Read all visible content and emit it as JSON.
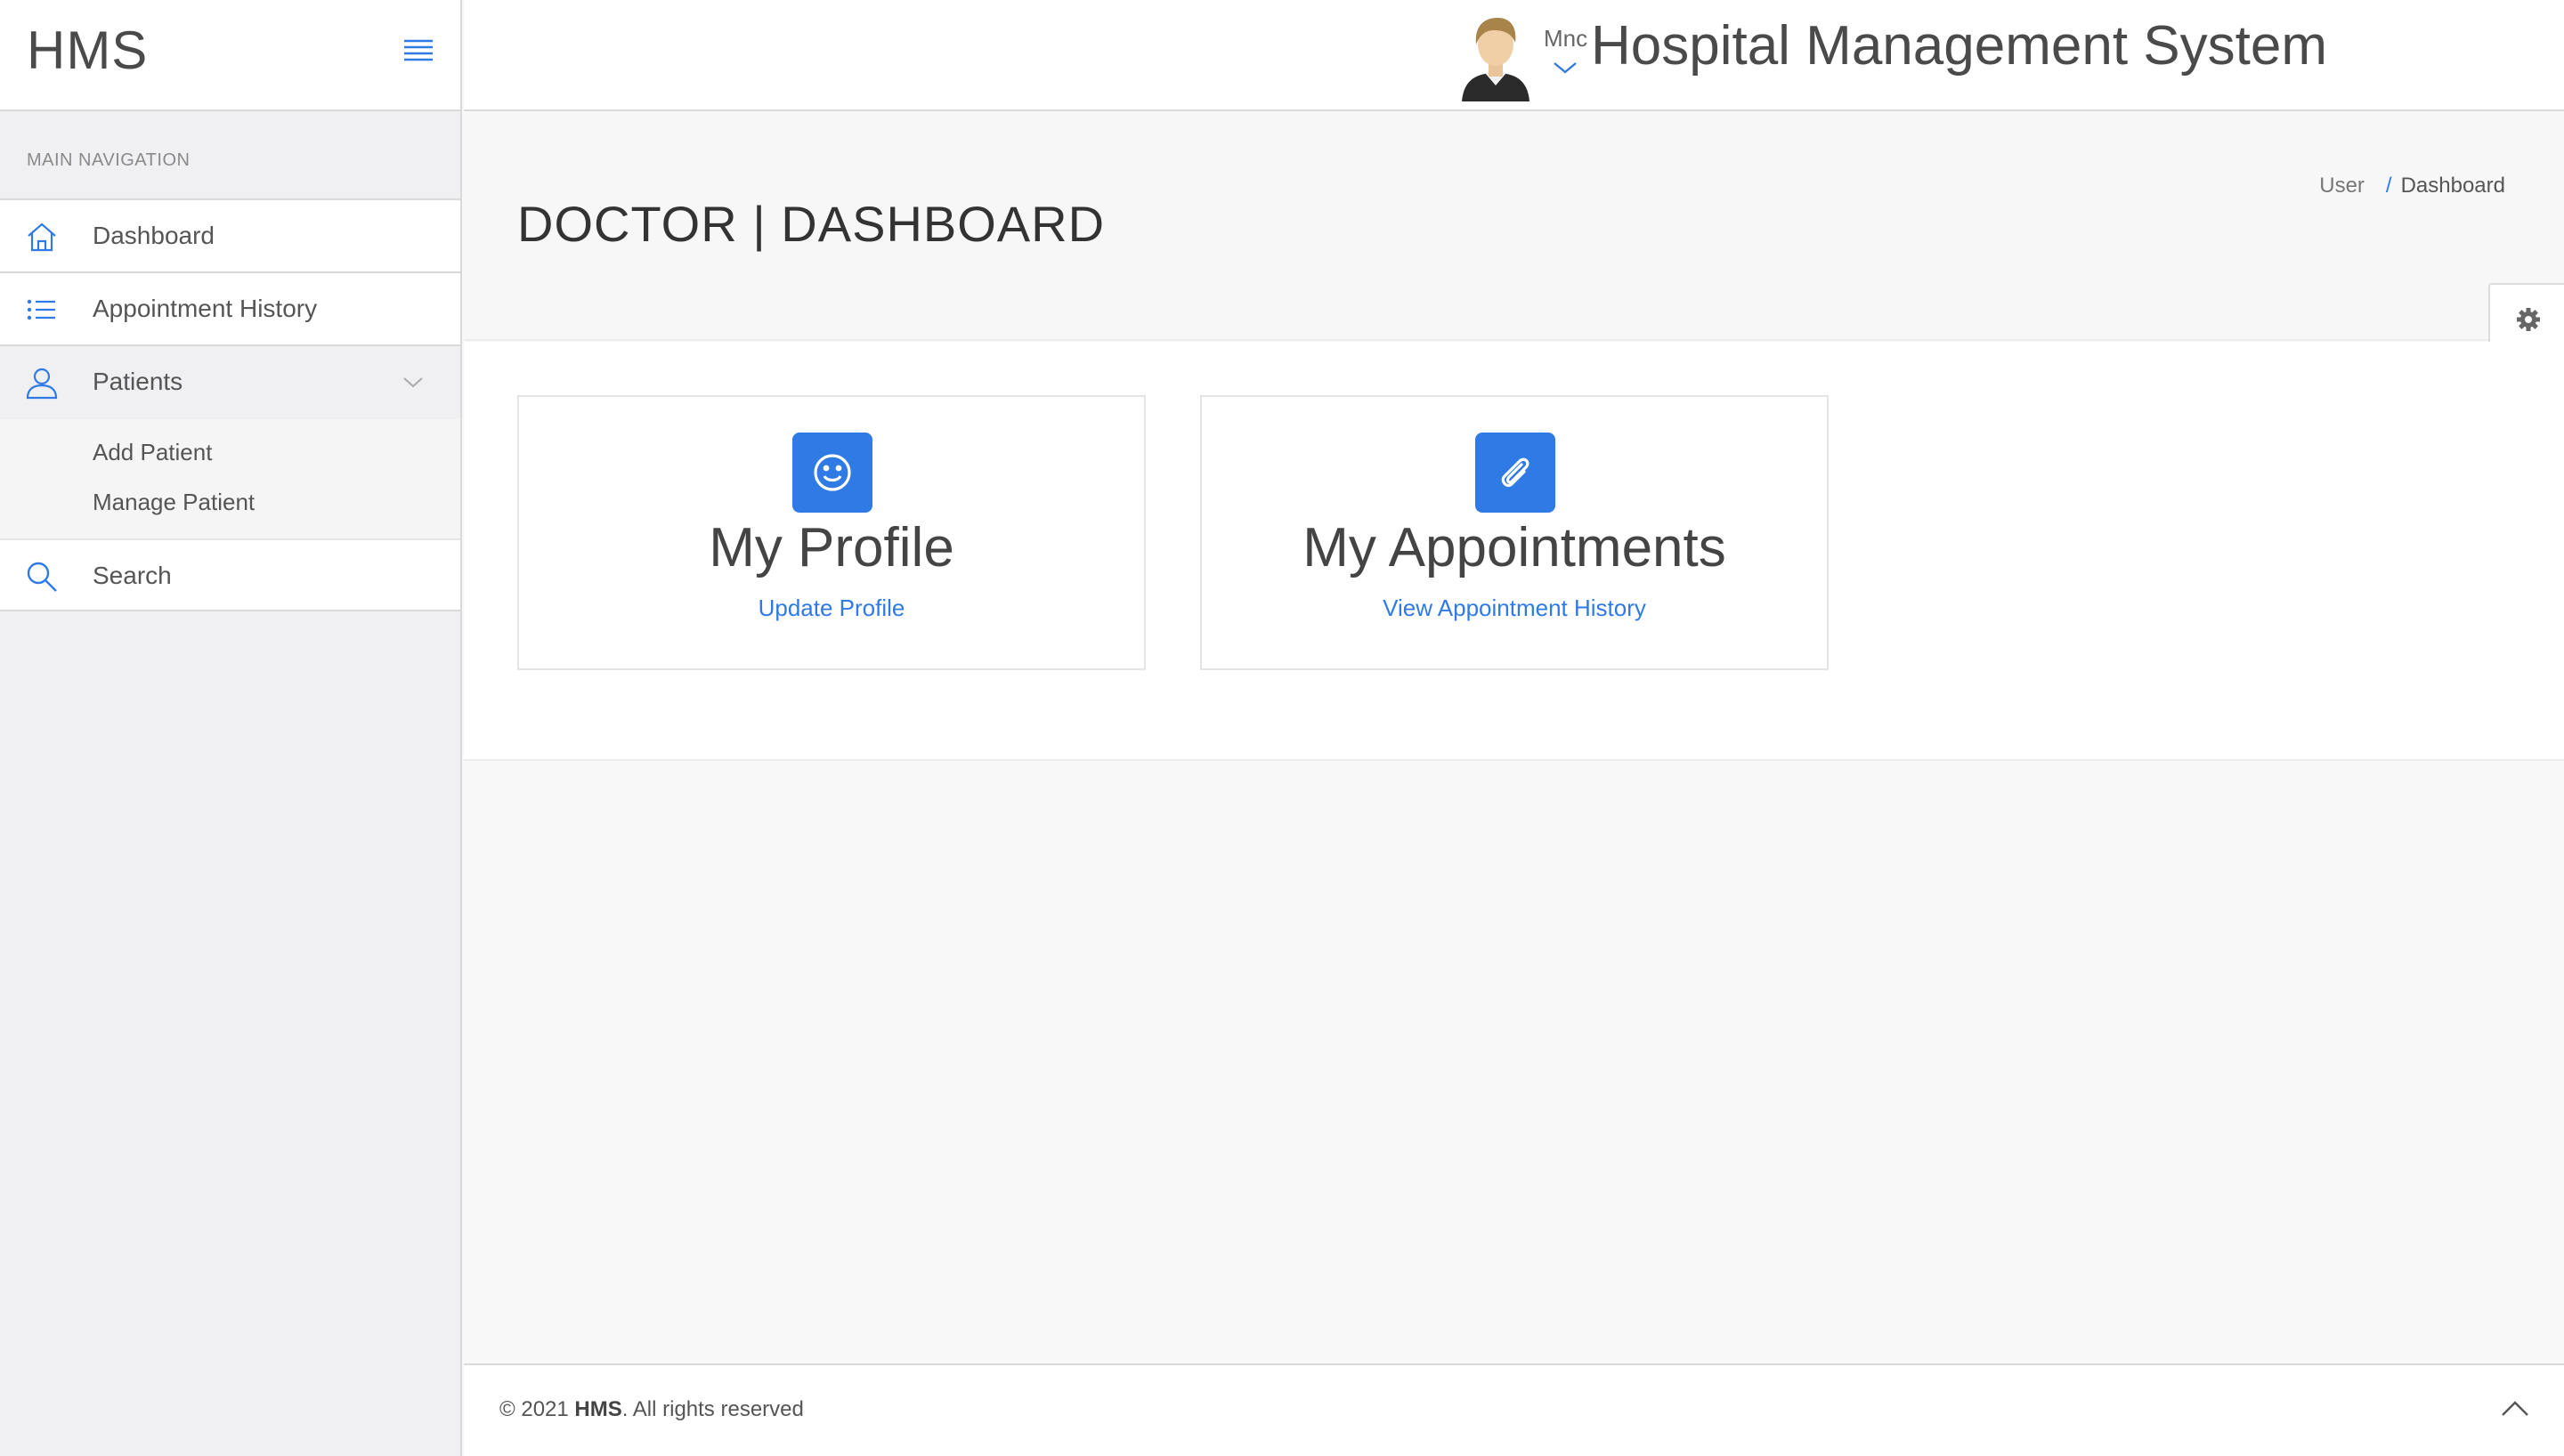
{
  "brand": {
    "name": "HMS"
  },
  "header": {
    "title": "Hospital Management System",
    "username": "Mnc"
  },
  "sidebar": {
    "section_label": "Main Navigation",
    "items": [
      {
        "label": "Dashboard",
        "icon": "home-icon"
      },
      {
        "label": "Appointment History",
        "icon": "list-icon"
      },
      {
        "label": "Patients",
        "icon": "user-icon",
        "expanded": true,
        "children": [
          {
            "label": "Add Patient"
          },
          {
            "label": "Manage Patient"
          }
        ]
      },
      {
        "label": "Search",
        "icon": "search-icon"
      }
    ]
  },
  "page": {
    "title": "DOCTOR | DASHBOARD",
    "breadcrumb": [
      "User",
      "Dashboard"
    ],
    "breadcrumb_sep": "/"
  },
  "cards": [
    {
      "title": "My Profile",
      "link": "Update Profile",
      "icon": "smile-icon"
    },
    {
      "title": "My Appointments",
      "link": "View Appointment History",
      "icon": "paperclip-icon"
    }
  ],
  "footer": {
    "prefix": "© 2021",
    "brand": "HMS",
    "suffix": ". All rights reserved"
  },
  "colors": {
    "accent": "#2f7ae5",
    "sidebar_bg": "#f0f0f2",
    "content_bg": "#f8f8f8"
  }
}
